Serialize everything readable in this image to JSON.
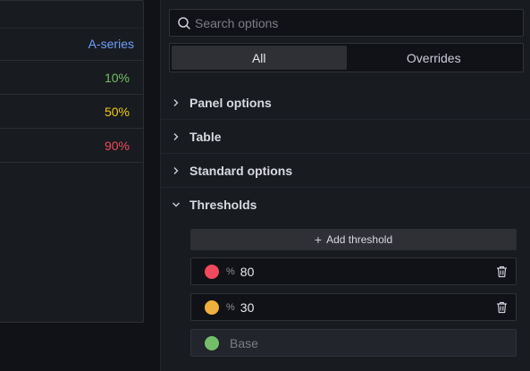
{
  "table": {
    "column_header": "A-series",
    "rows": [
      {
        "value": "10%",
        "color": "#73bf69"
      },
      {
        "value": "50%",
        "color": "#f2cc0c"
      },
      {
        "value": "90%",
        "color": "#f2495c"
      }
    ]
  },
  "options": {
    "search_placeholder": "Search options",
    "tabs": [
      {
        "label": "All",
        "active": true
      },
      {
        "label": "Overrides",
        "active": false
      }
    ],
    "sections": [
      {
        "label": "Panel options",
        "expanded": false
      },
      {
        "label": "Table",
        "expanded": false
      },
      {
        "label": "Standard options",
        "expanded": false
      },
      {
        "label": "Thresholds",
        "expanded": true
      }
    ],
    "thresholds": {
      "add_label": "Add threshold",
      "items": [
        {
          "color": "#f2495c",
          "unit": "%",
          "value": "80"
        },
        {
          "color": "#f0b13c",
          "unit": "%",
          "value": "30"
        }
      ],
      "base": {
        "color": "#73bf69",
        "label": "Base"
      }
    }
  },
  "icons": [
    "search-icon",
    "chevron-right-icon",
    "chevron-down-icon",
    "plus-icon",
    "trash-icon"
  ]
}
